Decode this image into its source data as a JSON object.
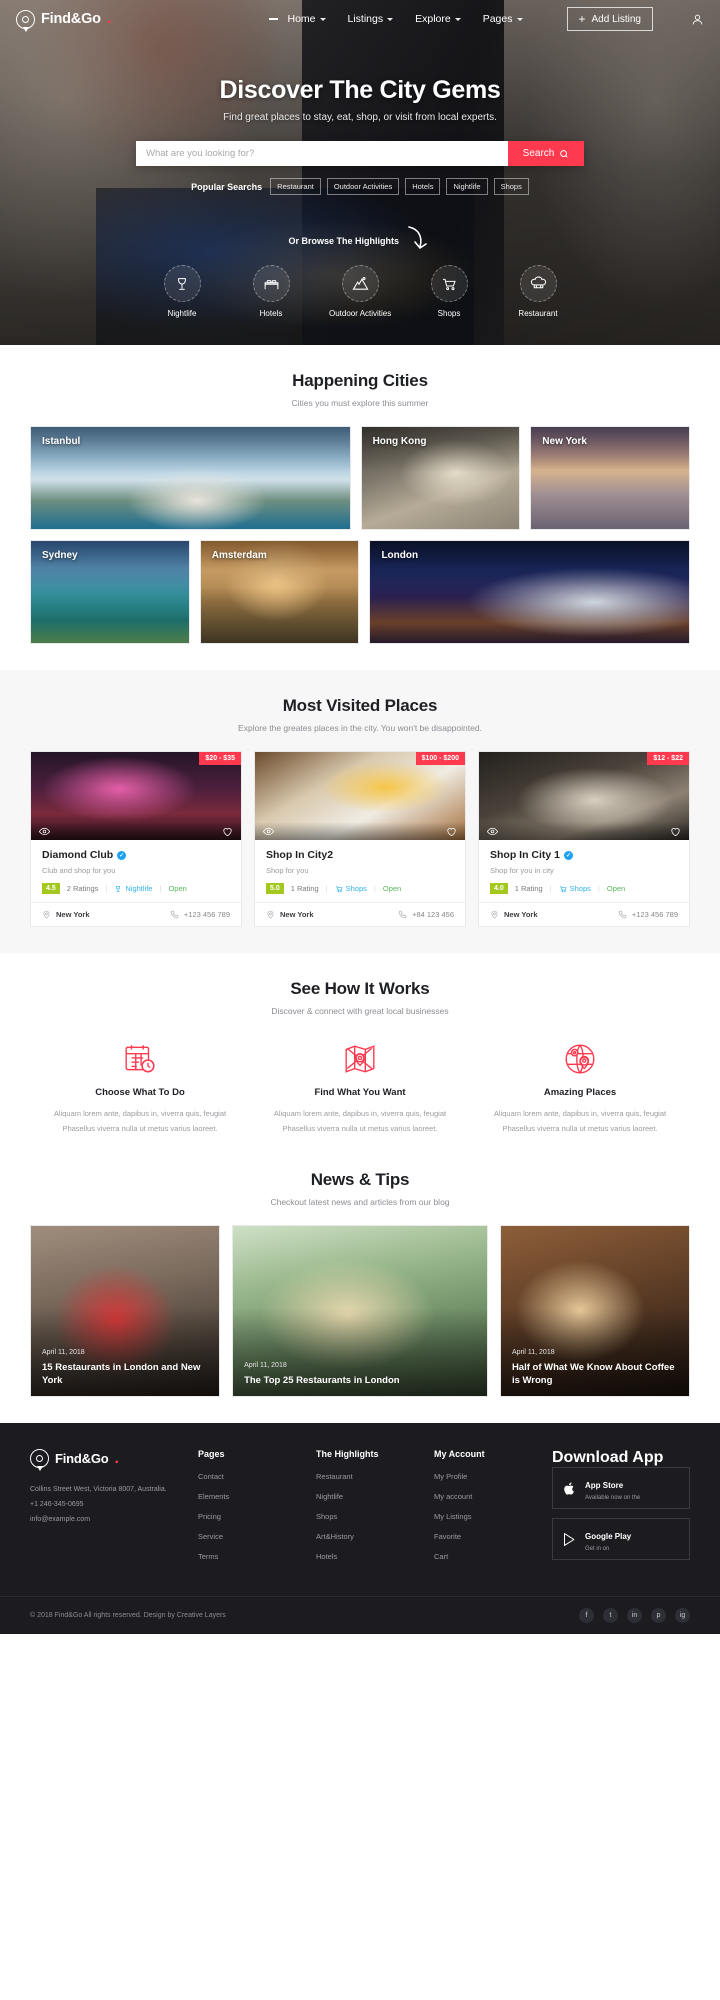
{
  "brand": {
    "name": "Find&Go",
    "dot": "."
  },
  "nav": {
    "items": [
      {
        "label": "Home",
        "caret": true,
        "dash": true
      },
      {
        "label": "Listings",
        "caret": true,
        "dash": false
      },
      {
        "label": "Explore",
        "caret": true,
        "dash": false
      },
      {
        "label": "Pages",
        "caret": true,
        "dash": false
      }
    ],
    "add_listing": "Add Listing",
    "plus": "+"
  },
  "hero": {
    "title": "Discover The City Gems",
    "subtitle": "Find great places to stay, eat, shop, or visit from local experts.",
    "search_placeholder": "What are you looking for?",
    "search_value": "",
    "search_button": "Search",
    "popular_label": "Popular Searchs",
    "tags": [
      "Restaurant",
      "Outdoor Activities",
      "Hotels",
      "Nightlife",
      "Shops"
    ],
    "browse_text": "Or Browse The Highlights",
    "categories": [
      {
        "label": "Nightlife",
        "icon": "cocktail-glass-icon"
      },
      {
        "label": "Hotels",
        "icon": "bed-icon"
      },
      {
        "label": "Outdoor Activities",
        "icon": "mountain-icon"
      },
      {
        "label": "Shops",
        "icon": "shopping-cart-icon"
      },
      {
        "label": "Restaurant",
        "icon": "chef-hat-icon"
      }
    ]
  },
  "cities": {
    "title": "Happening Cities",
    "subtitle": "Cities you must explore this summer",
    "row1": [
      {
        "name": "Istanbul",
        "img": "img-istanbul",
        "flex": 2.02
      },
      {
        "name": "Hong Kong",
        "img": "img-hongkong",
        "flex": 1
      },
      {
        "name": "New York",
        "img": "img-newyork",
        "flex": 1
      }
    ],
    "row2": [
      {
        "name": "Sydney",
        "img": "img-sydney",
        "flex": 1
      },
      {
        "name": "Amsterdam",
        "img": "img-amsterdam",
        "flex": 1
      },
      {
        "name": "London",
        "img": "img-london",
        "flex": 2.02
      }
    ]
  },
  "places": {
    "title": "Most Visited Places",
    "subtitle": "Explore the greates places in the city. You won't be disappointed.",
    "cards": [
      {
        "price": "$20 - $35",
        "img": "lc-1",
        "title": "Diamond Club",
        "verified": true,
        "desc": "Club and shop for you",
        "rating": "4.5",
        "ratings_count": "2 Ratings",
        "category": "Nightlife",
        "category_icon": "cocktail-glass-icon",
        "status": "Open",
        "location": "New York",
        "phone": "+123 456 789"
      },
      {
        "price": "$100 - $200",
        "img": "lc-2",
        "title": "Shop In City2",
        "verified": false,
        "desc": "Shop for you",
        "rating": "5.0",
        "ratings_count": "1 Rating",
        "category": "Shops",
        "category_icon": "shopping-cart-icon",
        "status": "Open",
        "location": "New York",
        "phone": "+84 123 456"
      },
      {
        "price": "$12 - $22",
        "img": "lc-3",
        "title": "Shop In City 1",
        "verified": true,
        "desc": "Shop for you in city",
        "rating": "4.0",
        "ratings_count": "1 Rating",
        "category": "Shops",
        "category_icon": "shopping-cart-icon",
        "status": "Open",
        "location": "New York",
        "phone": "+123 456 789"
      }
    ]
  },
  "works": {
    "title": "See How It Works",
    "subtitle": "Discover & connect with great local businesses",
    "items": [
      {
        "icon": "calendar-clock-icon",
        "title": "Choose What To Do",
        "text": "Aliquam lorem ante, dapibus in, viverra quis, feugiat Phasellus viverra nulla ut metus varius laoreet."
      },
      {
        "icon": "map-pin-icon",
        "title": "Find What You Want",
        "text": "Aliquam lorem ante, dapibus in, viverra quis, feugiat Phasellus viverra nulla ut metus varius laoreet."
      },
      {
        "icon": "globe-pin-icon",
        "title": "Amazing Places",
        "text": "Aliquam lorem ante, dapibus in, viverra quis, feugiat Phasellus viverra nulla ut metus varius laoreet."
      }
    ]
  },
  "news": {
    "title": "News & Tips",
    "subtitle": "Checkout latest news and articles from our blog",
    "posts": [
      {
        "date": "April 11, 2018",
        "title": "15 Restaurants in London and New York",
        "img": "bg-1",
        "flex": 1
      },
      {
        "date": "April 11, 2018",
        "title": "The Top 25 Restaurants in London",
        "img": "bg-2",
        "flex": 1.35
      },
      {
        "date": "April 11, 2018",
        "title": "Half of What We Know About Coffee is Wrong",
        "img": "bg-3",
        "flex": 1
      }
    ]
  },
  "footer": {
    "brand": "Find&Go",
    "address": "Collins Street West, Victoria 8007, Australia.",
    "phone": "+1 246-345-0695",
    "email": "info@example.com",
    "columns": [
      {
        "title": "Pages",
        "links": [
          "Contact",
          "Elements",
          "Pricing",
          "Service",
          "Terms"
        ]
      },
      {
        "title": "The Highlights",
        "links": [
          "Restaurant",
          "Nightlife",
          "Shops",
          "Art&History",
          "Hotels"
        ]
      },
      {
        "title": "My Account",
        "links": [
          "My Profile",
          "My account",
          "My Listings",
          "Favorite",
          "Cart"
        ]
      }
    ],
    "app": {
      "title": "Download App",
      "buttons": [
        {
          "icon": "apple-icon",
          "line1": "App Store",
          "line2": "Available now on the"
        },
        {
          "icon": "play-icon",
          "line1": "Google Play",
          "line2": "Get in on"
        }
      ]
    },
    "copyright": "© 2018 Find&Go All rights reserved. Design by Creative Layers",
    "socials": [
      "f",
      "t",
      "in",
      "p",
      "ig"
    ]
  }
}
